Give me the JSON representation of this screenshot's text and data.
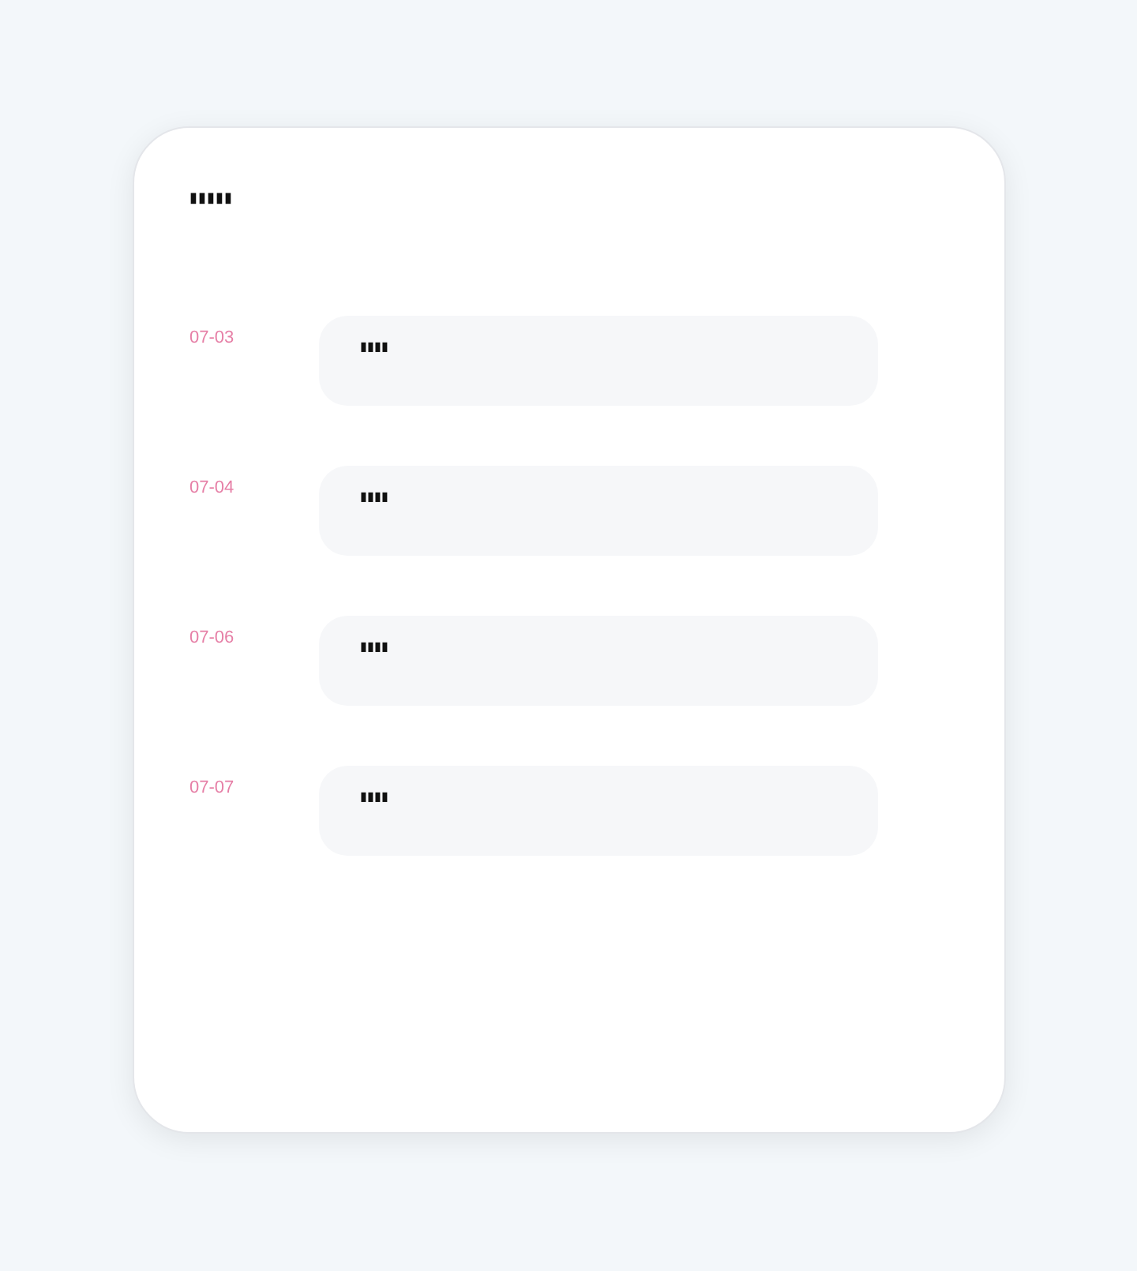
{
  "title": "▮▮▮▮▮",
  "entries": [
    {
      "date": "07-03",
      "text": "▮▮▮▮"
    },
    {
      "date": "07-04",
      "text": "▮▮▮▮"
    },
    {
      "date": "07-06",
      "text": "▮▮▮▮"
    },
    {
      "date": "07-07",
      "text": "▮▮▮▮"
    }
  ]
}
